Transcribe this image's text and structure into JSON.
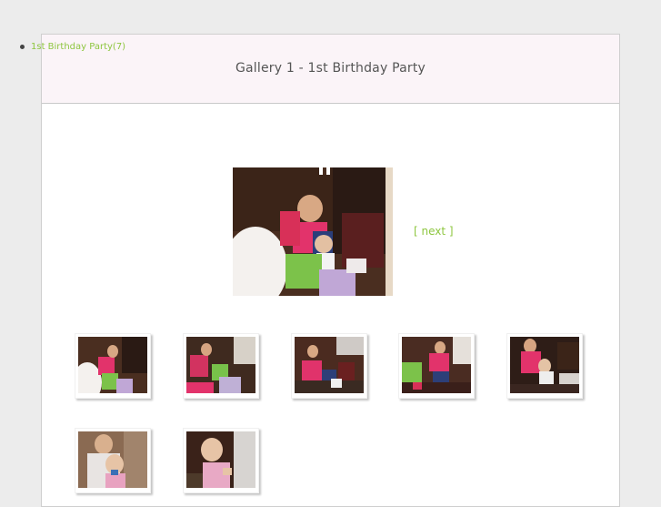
{
  "sidebar": {
    "items": [
      {
        "label": "1st Birthday Party",
        "count": "(7)"
      }
    ]
  },
  "gallery": {
    "title": "Gallery 1 - 1st Birthday Party",
    "next_label": "[ next ]"
  },
  "colors": {
    "accent": "#8ec640",
    "header_bg": "#fbf4f8",
    "page_bg": "#ececec",
    "title_text": "#555555"
  }
}
